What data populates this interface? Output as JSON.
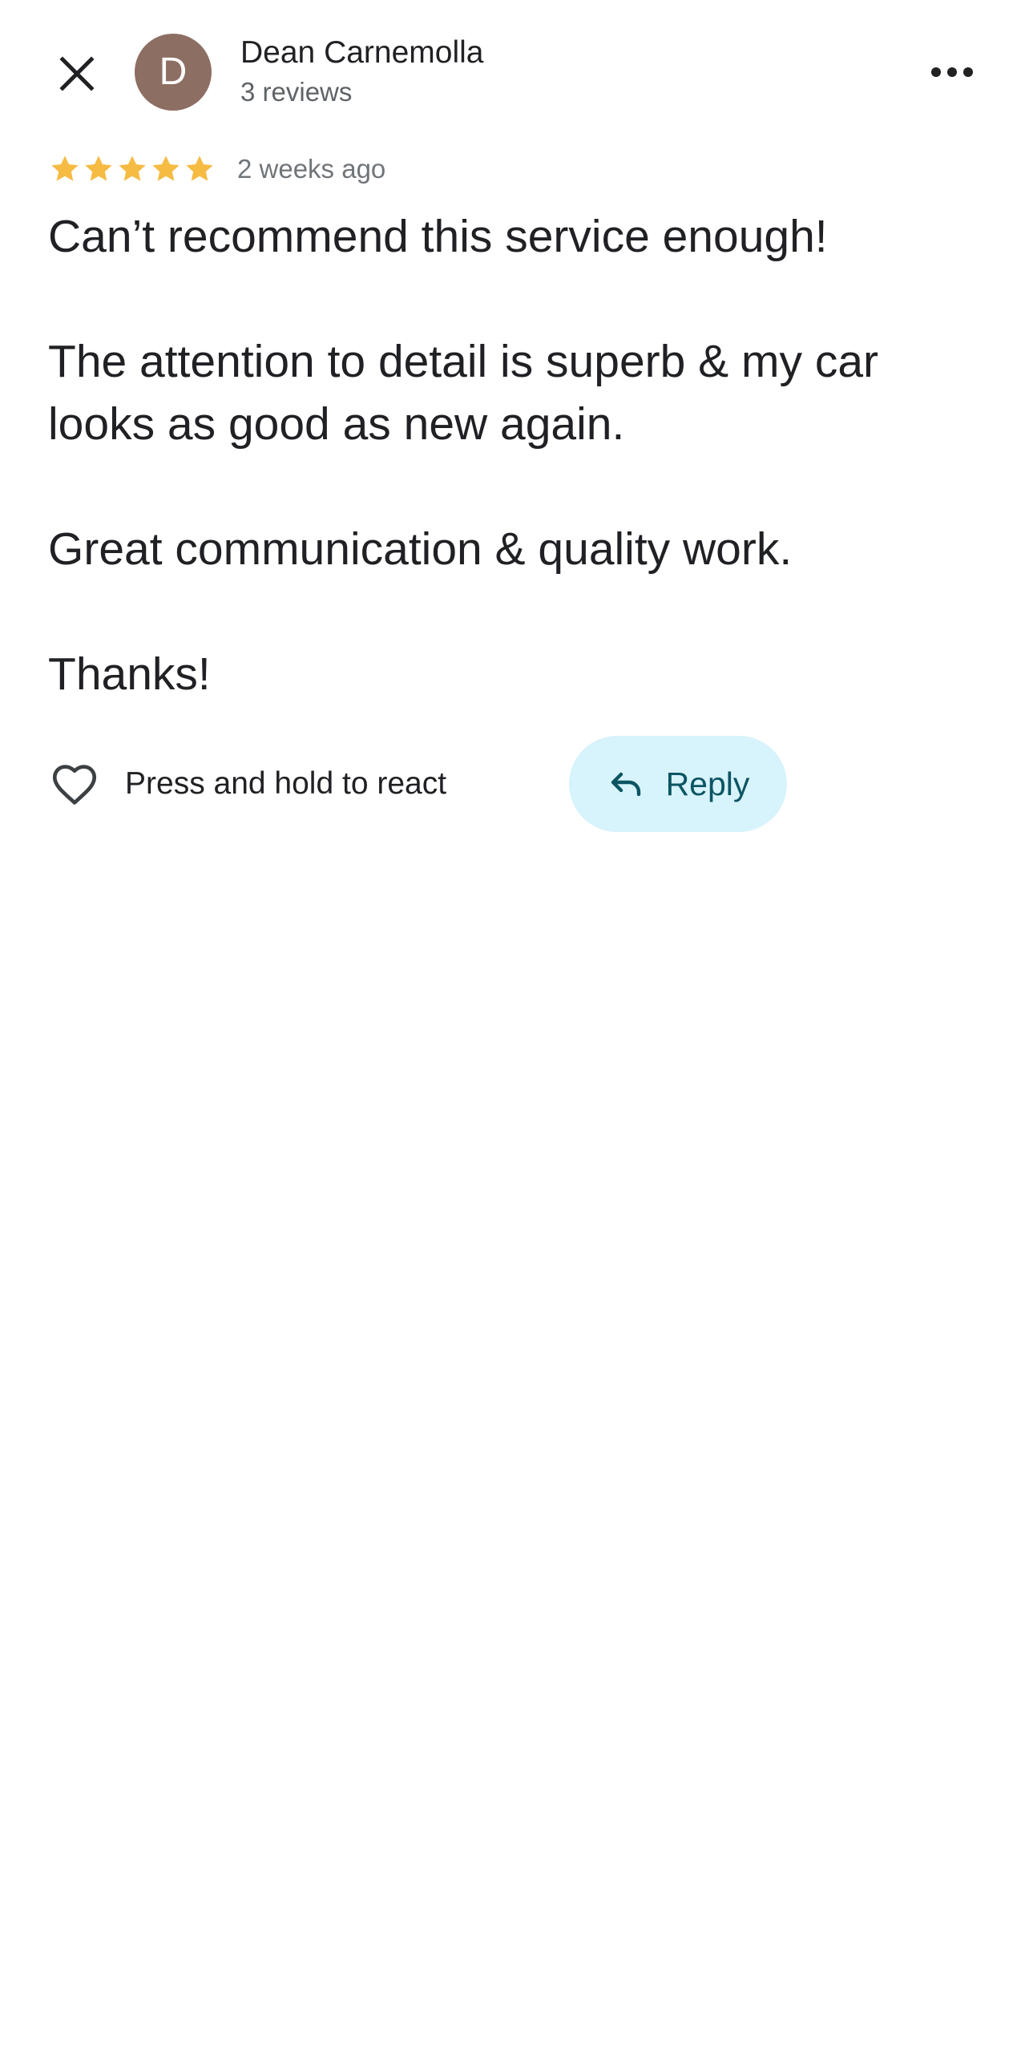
{
  "header": {
    "author_initial": "D",
    "author_name": "Dean Carnemolla",
    "author_meta": "3 reviews",
    "avatar_color": "#8d6e63",
    "close_icon": "close-icon",
    "more_icon": "more-horizontal-icon"
  },
  "review": {
    "rating": 5,
    "rating_max": 5,
    "star_color": "#f6bb42",
    "date": "2 weeks ago",
    "paragraphs": [
      "Can’t recommend this service enough!",
      "The attention to detail is superb & my car looks as good as new again.",
      "Great communication & quality work.",
      "Thanks!"
    ]
  },
  "actions": {
    "react_icon": "heart-outline-icon",
    "react_label": "Press and hold to react",
    "reply_icon": "reply-arrow-icon",
    "reply_label": "Reply",
    "reply_bg_color": "#d7f3fb",
    "reply_text_color": "#0b5563"
  }
}
